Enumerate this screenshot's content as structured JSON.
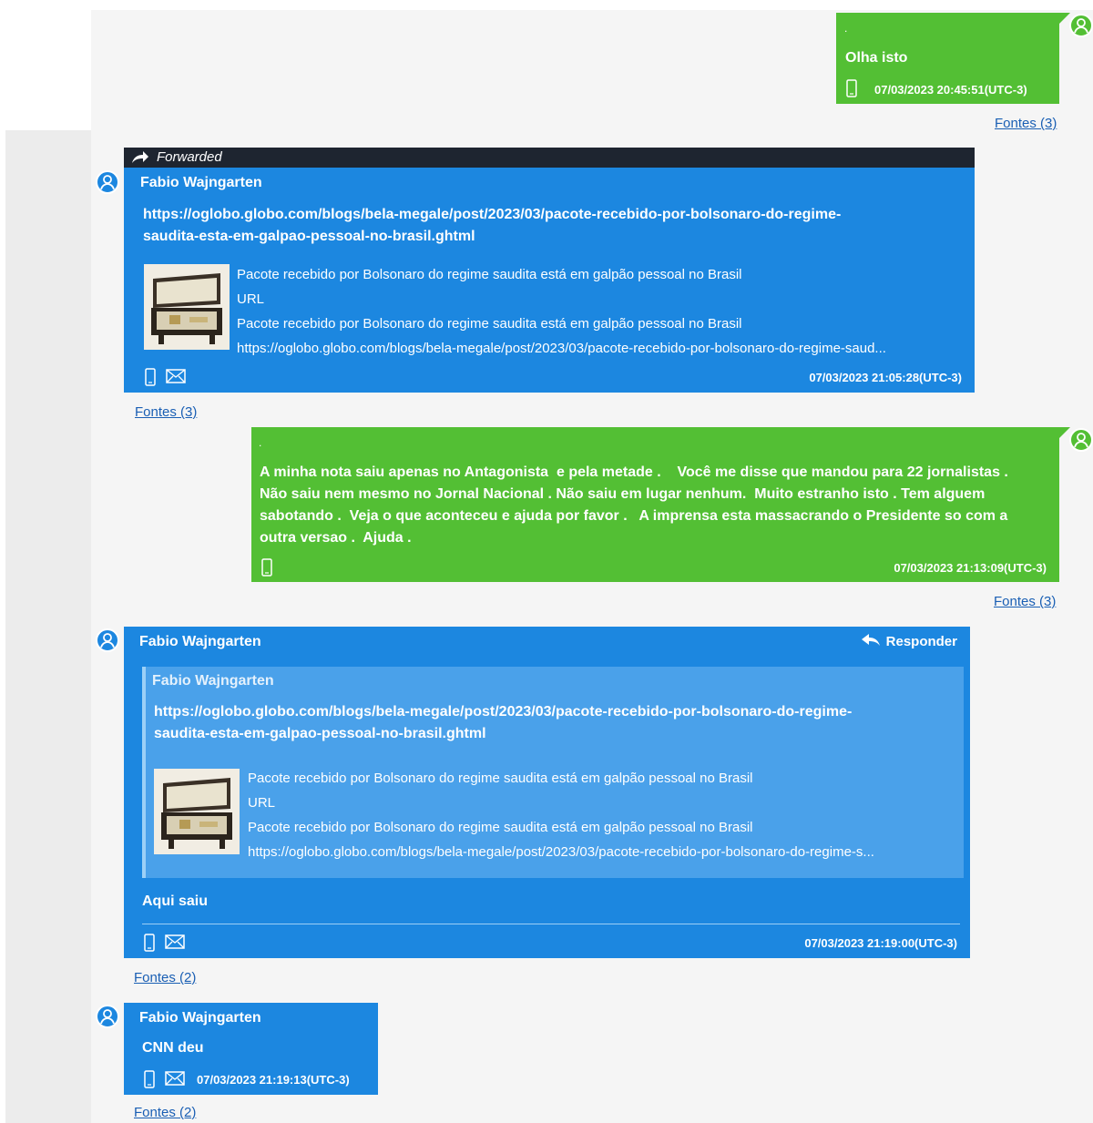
{
  "messages": [
    {
      "dot": ".",
      "text": "Olha isto",
      "timestamp": "07/03/2023 20:45:51(UTC-3)",
      "sources": "Fontes (3)"
    },
    {
      "forwarded_label": "Forwarded",
      "sender": "Fabio  Wajngarten",
      "link_line1": "https://oglobo.globo.com/blogs/bela-megale/post/2023/03/pacote-recebido-por-bolsonaro-do-regime-",
      "link_line2": "saudita-esta-em-galpao-pessoal-no-brasil.ghtml",
      "preview": {
        "title": "Pacote recebido por Bolsonaro do regime saudita está em galpão pessoal no Brasil",
        "type": "URL",
        "description": "Pacote recebido por Bolsonaro do regime saudita está em galpão pessoal no Brasil",
        "url": "https://oglobo.globo.com/blogs/bela-megale/post/2023/03/pacote-recebido-por-bolsonaro-do-regime-saud..."
      },
      "timestamp": "07/03/2023 21:05:28(UTC-3)",
      "sources": "Fontes (3)"
    },
    {
      "dot": ".",
      "line1": "A minha nota saiu apenas no Antagonista  e pela metade .    Você me disse que mandou para 22 jornalistas .",
      "line2": "Não saiu nem mesmo no Jornal Nacional . Não saiu em lugar nenhum.  Muito estranho isto . Tem alguem",
      "line3": "sabotando .  Veja o que aconteceu e ajuda por favor .   A imprensa esta massacrando o Presidente so com a",
      "line4": "outra versao .  Ajuda .",
      "timestamp": "07/03/2023 21:13:09(UTC-3)",
      "sources": "Fontes (3)"
    },
    {
      "sender": "Fabio  Wajngarten",
      "reply_label": "Responder",
      "quote": {
        "sender": "Fabio  Wajngarten",
        "link_line1": "https://oglobo.globo.com/blogs/bela-megale/post/2023/03/pacote-recebido-por-bolsonaro-do-regime-",
        "link_line2": "saudita-esta-em-galpao-pessoal-no-brasil.ghtml",
        "preview": {
          "title": "Pacote recebido por Bolsonaro do regime saudita está em galpão pessoal no Brasil",
          "type": "URL",
          "description": "Pacote recebido por Bolsonaro do regime saudita está em galpão pessoal no Brasil",
          "url": "https://oglobo.globo.com/blogs/bela-megale/post/2023/03/pacote-recebido-por-bolsonaro-do-regime-s..."
        }
      },
      "text": "Aqui saiu",
      "timestamp": "07/03/2023 21:19:00(UTC-3)",
      "sources": "Fontes (2)"
    },
    {
      "sender": "Fabio  Wajngarten",
      "text": "CNN deu",
      "timestamp": "07/03/2023 21:19:13(UTC-3)",
      "sources": "Fontes (2)"
    }
  ],
  "colors": {
    "incoming": "#1c87e0",
    "outgoing": "#53bf34",
    "link": "#1a5fb4"
  },
  "icons": [
    "user-avatar-icon",
    "forward-arrow-icon",
    "phone-icon",
    "mail-icon",
    "reply-arrow-icon"
  ]
}
